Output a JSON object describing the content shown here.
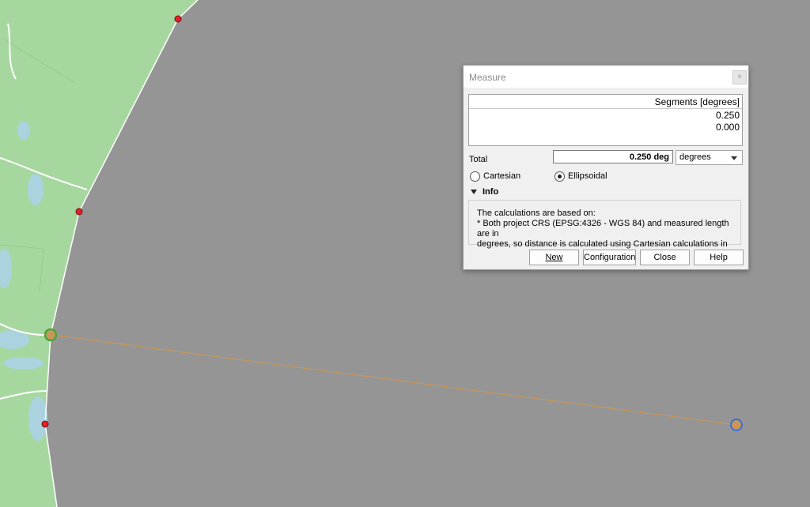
{
  "dialog": {
    "title": "Measure",
    "segments_header": "Segments [degrees]",
    "segments": [
      "0.250",
      "0.000"
    ],
    "total_label": "Total",
    "total_value": "0.250 deg",
    "units_selected": "degrees",
    "radio_cartesian": "Cartesian",
    "radio_ellipsoidal": "Ellipsoidal",
    "ellipsoidal_checked": true,
    "info_label": "Info",
    "info_lines": [
      "The calculations are based on:",
      "* Both project CRS (EPSG:4326 - WGS 84) and measured length are in",
      "degrees, so distance is calculated using Cartesian calculations in"
    ],
    "buttons": {
      "new": "New",
      "configuration": "Configuration",
      "close": "Close",
      "help": "Help"
    }
  },
  "colors": {
    "map_green": "#a6d79f",
    "background_gray": "#959595",
    "measure_line": "#c8965a",
    "vertex_red": "#e0222a",
    "start_marker": "#4aa53a",
    "end_marker": "#3a6fd6"
  }
}
